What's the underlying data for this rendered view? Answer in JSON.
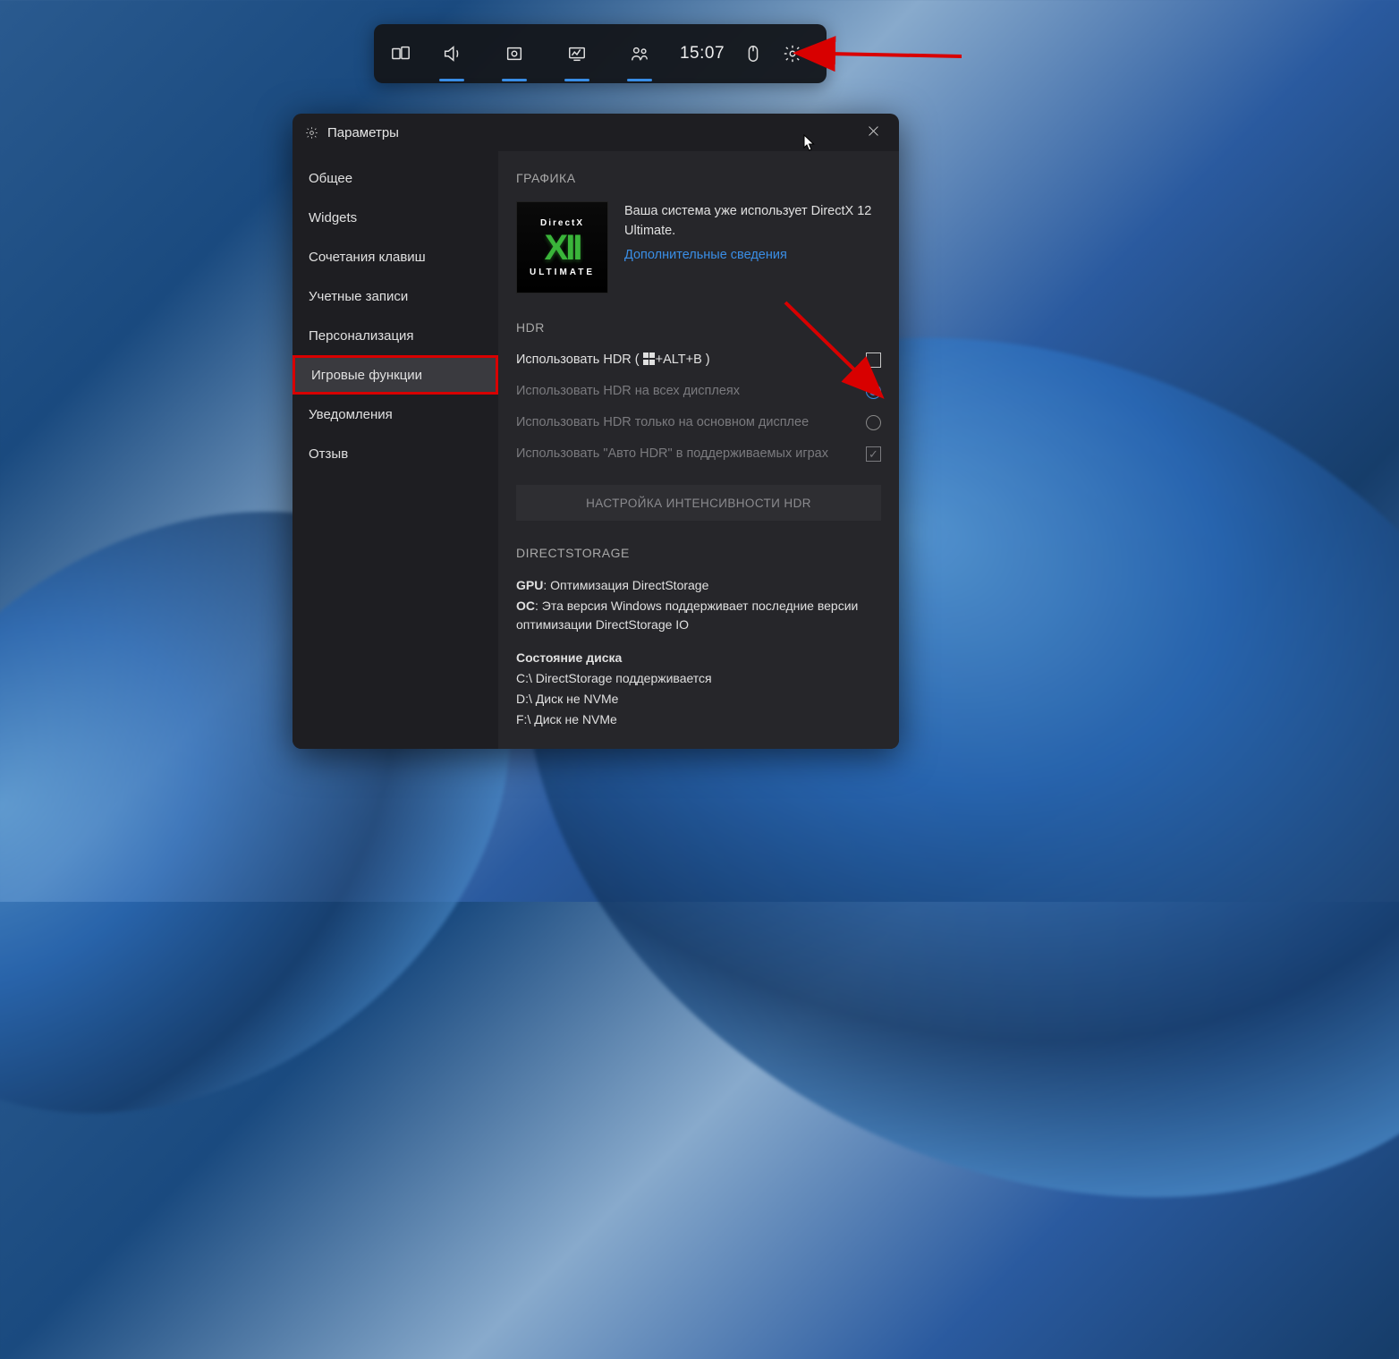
{
  "gamebar": {
    "time": "15:07"
  },
  "panel": {
    "title": "Параметры"
  },
  "sidebar": {
    "items": [
      {
        "label": "Общее"
      },
      {
        "label": "Widgets"
      },
      {
        "label": "Сочетания клавиш"
      },
      {
        "label": "Учетные записи"
      },
      {
        "label": "Персонализация"
      },
      {
        "label": "Игровые функции"
      },
      {
        "label": "Уведомления"
      },
      {
        "label": "Отзыв"
      }
    ]
  },
  "content": {
    "graphics_title": "ГРАФИКА",
    "dx_badge_top": "DirectX",
    "dx_badge_mid": "XII",
    "dx_badge_bot": "ULTIMATE",
    "dx_text": "Ваша система уже использует DirectX 12 Ultimate.",
    "dx_link": "Дополнительные сведения",
    "hdr_title": "HDR",
    "hdr_use_prefix": "Использовать HDR ( ",
    "hdr_use_suffix": "+ALT+B )",
    "hdr_all_displays": "Использовать HDR на всех дисплеях",
    "hdr_main_display": "Использовать HDR только на основном дисплее",
    "hdr_auto": "Использовать \"Авто HDR\" в поддерживаемых играх",
    "hdr_intensity_btn": "НАСТРОЙКА ИНТЕНСИВНОСТИ HDR",
    "ds_title": "DIRECTSTORAGE",
    "ds_gpu_label": "GPU",
    "ds_gpu_text": ": Оптимизация DirectStorage",
    "ds_os_label": "ОС",
    "ds_os_text": ": Эта версия Windows поддерживает последние версии оптимизации DirectStorage IO",
    "ds_disk_state": "Состояние диска",
    "ds_disk_c": "C:\\ DirectStorage поддерживается",
    "ds_disk_d": "D:\\ Диск не NVMe",
    "ds_disk_f": "F:\\ Диск не NVMe"
  }
}
